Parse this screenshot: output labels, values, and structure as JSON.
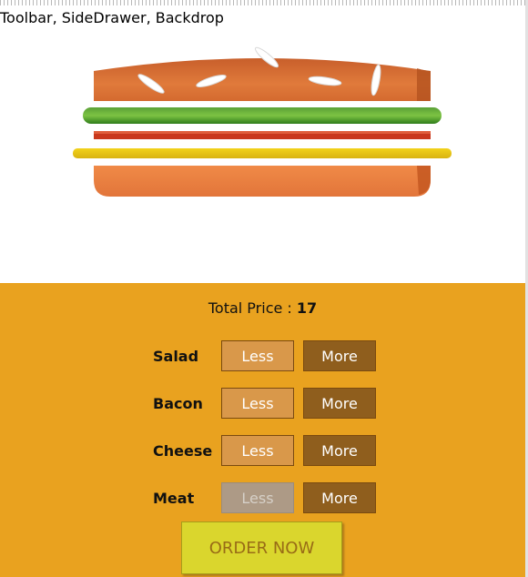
{
  "toolbar": {
    "text": "Toolbar, SideDrawer, Backdrop"
  },
  "colors": {
    "controls_bg": "#e9a21f",
    "less_button": "#d9984a",
    "more_button": "#8f5e1d",
    "less_disabled": "#ad9a86",
    "order_button": "#dad62d",
    "order_text": "#996c16"
  },
  "price": {
    "label": "Total Price : ",
    "value": "17"
  },
  "controls": [
    {
      "label": "Salad",
      "less": "Less",
      "more": "More",
      "less_disabled": false
    },
    {
      "label": "Bacon",
      "less": "Less",
      "more": "More",
      "less_disabled": false
    },
    {
      "label": "Cheese",
      "less": "Less",
      "more": "More",
      "less_disabled": false
    },
    {
      "label": "Meat",
      "less": "Less",
      "more": "More",
      "less_disabled": true
    }
  ],
  "order_button": {
    "label": "ORDER NOW"
  },
  "burger": {
    "ingredients": [
      "bread-top",
      "salad",
      "bacon",
      "cheese",
      "bread-bottom"
    ]
  }
}
